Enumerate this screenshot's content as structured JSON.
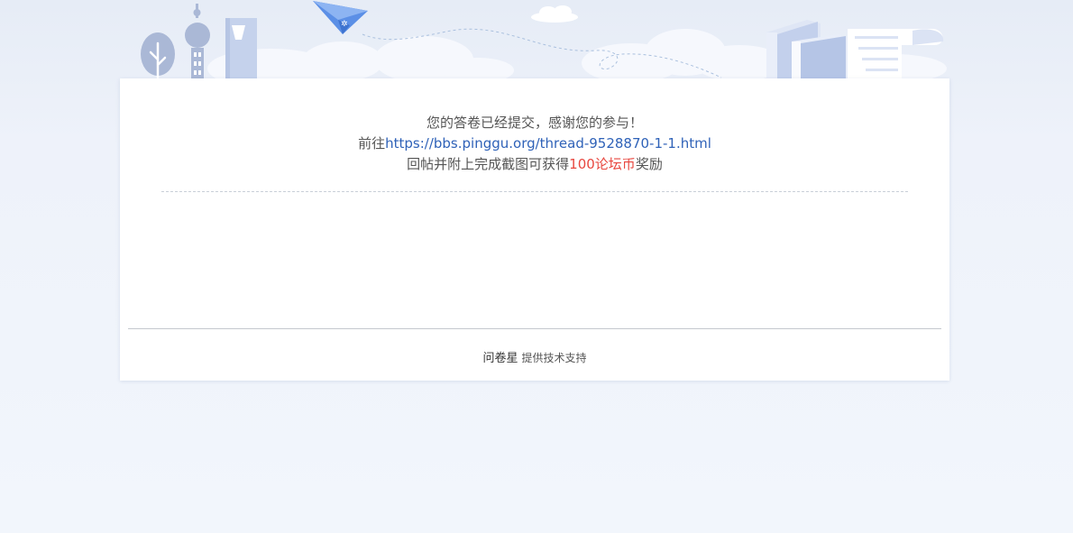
{
  "message": {
    "line1": "您的答卷已经提交，感谢您的参与！",
    "line2_prefix": "前往",
    "line2_link": "https://bbs.pinggu.org/thread-9528870-1-1.html",
    "line3_prefix": "回帖并附上完成截图可获得",
    "line3_highlight": "100论坛币",
    "line3_suffix": "奖励"
  },
  "footer": {
    "brand": "问卷星",
    "support": "提供技术支持"
  },
  "colors": {
    "link": "#2f62b8",
    "highlight": "#e8473f",
    "background": "#f2f6fc"
  },
  "icons": [
    "tree-icon",
    "tv-tower-icon",
    "skyscraper-icon",
    "paper-plane-icon",
    "cloud-icon",
    "books-icon",
    "paper-scroll-icon"
  ]
}
